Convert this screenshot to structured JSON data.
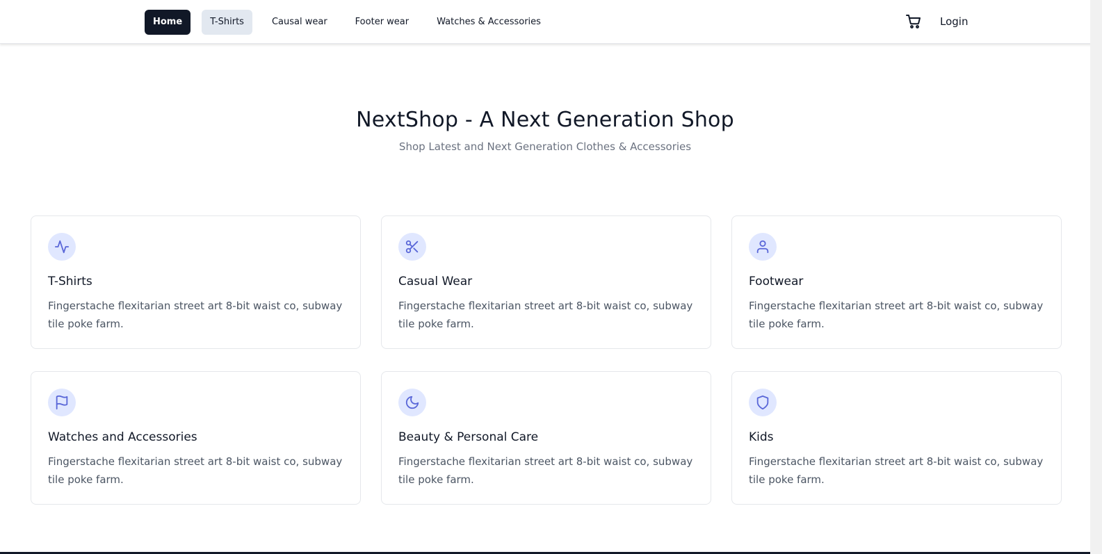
{
  "nav": {
    "links": [
      {
        "label": "Home"
      },
      {
        "label": "T-Shirts"
      },
      {
        "label": "Causal wear"
      },
      {
        "label": "Footer wear"
      },
      {
        "label": "Watches & Accessories"
      }
    ],
    "login_label": "Login",
    "cart_icon": "cart-icon"
  },
  "hero": {
    "title": "NextShop - A Next Generation Shop",
    "subtitle": "Shop Latest and Next Generation Clothes & Accessories"
  },
  "colors": {
    "accent": "#5a67d8",
    "icon_bg": "#e0e7ff",
    "active_nav_bg": "#111827",
    "hover_nav_bg": "#e2e8f0"
  },
  "categories": [
    {
      "icon": "activity-icon",
      "title": "T-Shirts",
      "description": "Fingerstache flexitarian street art 8-bit waist co, subway tile poke farm."
    },
    {
      "icon": "scissors-icon",
      "title": "Casual Wear",
      "description": "Fingerstache flexitarian street art 8-bit waist co, subway tile poke farm."
    },
    {
      "icon": "user-icon",
      "title": "Footwear",
      "description": "Fingerstache flexitarian street art 8-bit waist co, subway tile poke farm."
    },
    {
      "icon": "flag-icon",
      "title": "Watches and Accessories",
      "description": "Fingerstache flexitarian street art 8-bit waist co, subway tile poke farm."
    },
    {
      "icon": "moon-icon",
      "title": "Beauty & Personal Care",
      "description": "Fingerstache flexitarian street art 8-bit waist co, subway tile poke farm."
    },
    {
      "icon": "shield-icon",
      "title": "Kids",
      "description": "Fingerstache flexitarian street art 8-bit waist co, subway tile poke farm."
    }
  ]
}
